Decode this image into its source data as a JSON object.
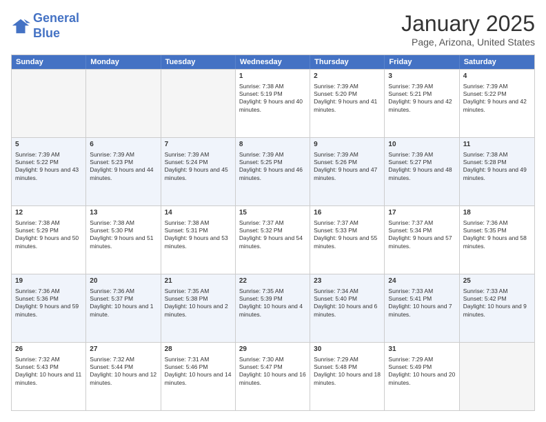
{
  "header": {
    "logo_line1": "General",
    "logo_line2": "Blue",
    "title": "January 2025",
    "subtitle": "Page, Arizona, United States"
  },
  "weekdays": [
    "Sunday",
    "Monday",
    "Tuesday",
    "Wednesday",
    "Thursday",
    "Friday",
    "Saturday"
  ],
  "rows": [
    {
      "alt": false,
      "cells": [
        {
          "day": "",
          "sunrise": "",
          "sunset": "",
          "daylight": "",
          "empty": true
        },
        {
          "day": "",
          "sunrise": "",
          "sunset": "",
          "daylight": "",
          "empty": true
        },
        {
          "day": "",
          "sunrise": "",
          "sunset": "",
          "daylight": "",
          "empty": true
        },
        {
          "day": "1",
          "sunrise": "Sunrise: 7:38 AM",
          "sunset": "Sunset: 5:19 PM",
          "daylight": "Daylight: 9 hours and 40 minutes."
        },
        {
          "day": "2",
          "sunrise": "Sunrise: 7:39 AM",
          "sunset": "Sunset: 5:20 PM",
          "daylight": "Daylight: 9 hours and 41 minutes."
        },
        {
          "day": "3",
          "sunrise": "Sunrise: 7:39 AM",
          "sunset": "Sunset: 5:21 PM",
          "daylight": "Daylight: 9 hours and 42 minutes."
        },
        {
          "day": "4",
          "sunrise": "Sunrise: 7:39 AM",
          "sunset": "Sunset: 5:22 PM",
          "daylight": "Daylight: 9 hours and 42 minutes."
        }
      ]
    },
    {
      "alt": true,
      "cells": [
        {
          "day": "5",
          "sunrise": "Sunrise: 7:39 AM",
          "sunset": "Sunset: 5:22 PM",
          "daylight": "Daylight: 9 hours and 43 minutes."
        },
        {
          "day": "6",
          "sunrise": "Sunrise: 7:39 AM",
          "sunset": "Sunset: 5:23 PM",
          "daylight": "Daylight: 9 hours and 44 minutes."
        },
        {
          "day": "7",
          "sunrise": "Sunrise: 7:39 AM",
          "sunset": "Sunset: 5:24 PM",
          "daylight": "Daylight: 9 hours and 45 minutes."
        },
        {
          "day": "8",
          "sunrise": "Sunrise: 7:39 AM",
          "sunset": "Sunset: 5:25 PM",
          "daylight": "Daylight: 9 hours and 46 minutes."
        },
        {
          "day": "9",
          "sunrise": "Sunrise: 7:39 AM",
          "sunset": "Sunset: 5:26 PM",
          "daylight": "Daylight: 9 hours and 47 minutes."
        },
        {
          "day": "10",
          "sunrise": "Sunrise: 7:39 AM",
          "sunset": "Sunset: 5:27 PM",
          "daylight": "Daylight: 9 hours and 48 minutes."
        },
        {
          "day": "11",
          "sunrise": "Sunrise: 7:38 AM",
          "sunset": "Sunset: 5:28 PM",
          "daylight": "Daylight: 9 hours and 49 minutes."
        }
      ]
    },
    {
      "alt": false,
      "cells": [
        {
          "day": "12",
          "sunrise": "Sunrise: 7:38 AM",
          "sunset": "Sunset: 5:29 PM",
          "daylight": "Daylight: 9 hours and 50 minutes."
        },
        {
          "day": "13",
          "sunrise": "Sunrise: 7:38 AM",
          "sunset": "Sunset: 5:30 PM",
          "daylight": "Daylight: 9 hours and 51 minutes."
        },
        {
          "day": "14",
          "sunrise": "Sunrise: 7:38 AM",
          "sunset": "Sunset: 5:31 PM",
          "daylight": "Daylight: 9 hours and 53 minutes."
        },
        {
          "day": "15",
          "sunrise": "Sunrise: 7:37 AM",
          "sunset": "Sunset: 5:32 PM",
          "daylight": "Daylight: 9 hours and 54 minutes."
        },
        {
          "day": "16",
          "sunrise": "Sunrise: 7:37 AM",
          "sunset": "Sunset: 5:33 PM",
          "daylight": "Daylight: 9 hours and 55 minutes."
        },
        {
          "day": "17",
          "sunrise": "Sunrise: 7:37 AM",
          "sunset": "Sunset: 5:34 PM",
          "daylight": "Daylight: 9 hours and 57 minutes."
        },
        {
          "day": "18",
          "sunrise": "Sunrise: 7:36 AM",
          "sunset": "Sunset: 5:35 PM",
          "daylight": "Daylight: 9 hours and 58 minutes."
        }
      ]
    },
    {
      "alt": true,
      "cells": [
        {
          "day": "19",
          "sunrise": "Sunrise: 7:36 AM",
          "sunset": "Sunset: 5:36 PM",
          "daylight": "Daylight: 9 hours and 59 minutes."
        },
        {
          "day": "20",
          "sunrise": "Sunrise: 7:36 AM",
          "sunset": "Sunset: 5:37 PM",
          "daylight": "Daylight: 10 hours and 1 minute."
        },
        {
          "day": "21",
          "sunrise": "Sunrise: 7:35 AM",
          "sunset": "Sunset: 5:38 PM",
          "daylight": "Daylight: 10 hours and 2 minutes."
        },
        {
          "day": "22",
          "sunrise": "Sunrise: 7:35 AM",
          "sunset": "Sunset: 5:39 PM",
          "daylight": "Daylight: 10 hours and 4 minutes."
        },
        {
          "day": "23",
          "sunrise": "Sunrise: 7:34 AM",
          "sunset": "Sunset: 5:40 PM",
          "daylight": "Daylight: 10 hours and 6 minutes."
        },
        {
          "day": "24",
          "sunrise": "Sunrise: 7:33 AM",
          "sunset": "Sunset: 5:41 PM",
          "daylight": "Daylight: 10 hours and 7 minutes."
        },
        {
          "day": "25",
          "sunrise": "Sunrise: 7:33 AM",
          "sunset": "Sunset: 5:42 PM",
          "daylight": "Daylight: 10 hours and 9 minutes."
        }
      ]
    },
    {
      "alt": false,
      "cells": [
        {
          "day": "26",
          "sunrise": "Sunrise: 7:32 AM",
          "sunset": "Sunset: 5:43 PM",
          "daylight": "Daylight: 10 hours and 11 minutes."
        },
        {
          "day": "27",
          "sunrise": "Sunrise: 7:32 AM",
          "sunset": "Sunset: 5:44 PM",
          "daylight": "Daylight: 10 hours and 12 minutes."
        },
        {
          "day": "28",
          "sunrise": "Sunrise: 7:31 AM",
          "sunset": "Sunset: 5:46 PM",
          "daylight": "Daylight: 10 hours and 14 minutes."
        },
        {
          "day": "29",
          "sunrise": "Sunrise: 7:30 AM",
          "sunset": "Sunset: 5:47 PM",
          "daylight": "Daylight: 10 hours and 16 minutes."
        },
        {
          "day": "30",
          "sunrise": "Sunrise: 7:29 AM",
          "sunset": "Sunset: 5:48 PM",
          "daylight": "Daylight: 10 hours and 18 minutes."
        },
        {
          "day": "31",
          "sunrise": "Sunrise: 7:29 AM",
          "sunset": "Sunset: 5:49 PM",
          "daylight": "Daylight: 10 hours and 20 minutes."
        },
        {
          "day": "",
          "sunrise": "",
          "sunset": "",
          "daylight": "",
          "empty": true
        }
      ]
    }
  ]
}
